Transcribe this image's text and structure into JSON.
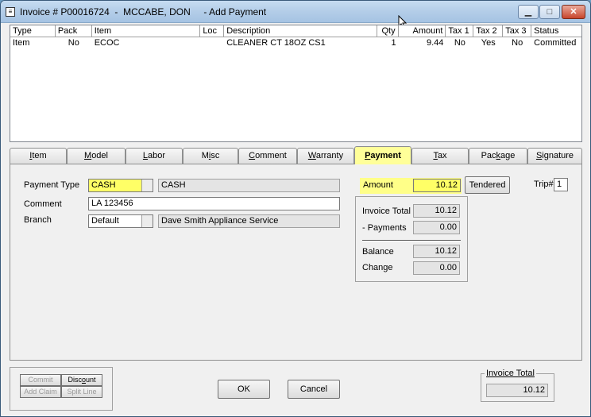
{
  "window": {
    "title": "Invoice # P00016724  -  MCCABE, DON     - Add Payment",
    "icon": "document-icon",
    "buttons": {
      "minimize": "▁",
      "maximize": "□",
      "close": "✕"
    }
  },
  "grid": {
    "columns": [
      "Type",
      "Pack",
      "Item",
      "Loc",
      "Description",
      "Qty",
      "Amount",
      "Tax 1",
      "Tax 2",
      "Tax 3",
      "Status"
    ],
    "rows": [
      {
        "type": "Item",
        "pack": "No",
        "item": "ECOC",
        "loc": "",
        "description": "CLEANER CT 18OZ CS1",
        "qty": "1",
        "amount": "9.44",
        "tax1": "No",
        "tax2": "Yes",
        "tax3": "No",
        "status": "Committed"
      }
    ]
  },
  "tabs": [
    {
      "pre": "",
      "key": "I",
      "post": "tem"
    },
    {
      "pre": "",
      "key": "M",
      "post": "odel"
    },
    {
      "pre": "",
      "key": "L",
      "post": "abor"
    },
    {
      "pre": "M",
      "key": "i",
      "post": "sc"
    },
    {
      "pre": "",
      "key": "C",
      "post": "omment"
    },
    {
      "pre": "",
      "key": "W",
      "post": "arranty"
    },
    {
      "pre": "",
      "key": "P",
      "post": "ayment"
    },
    {
      "pre": "",
      "key": "T",
      "post": "ax"
    },
    {
      "pre": "Pac",
      "key": "k",
      "post": "age"
    },
    {
      "pre": "",
      "key": "S",
      "post": "ignature"
    }
  ],
  "payment": {
    "payment_type_label": "Payment Type",
    "payment_type_code": "CASH",
    "payment_type_desc": "CASH",
    "comment_label": "Comment",
    "comment_value": "LA 123456",
    "branch_label": "Branch",
    "branch_code": "Default",
    "branch_desc": "Dave Smith Appliance Service",
    "amount_label": "Amount",
    "amount_value": "10.12",
    "tendered_label": "Tendered",
    "trip_label": "Trip#",
    "trip_value": "1",
    "invoice_total_label": "Invoice Total",
    "invoice_total_value": "10.12",
    "payments_label": "- Payments",
    "payments_value": "0.00",
    "balance_label": "Balance",
    "balance_value": "10.12",
    "change_label": "Change",
    "change_value": "0.00"
  },
  "footer": {
    "commit": "Commit",
    "discount_pre": "Disc",
    "discount_key": "o",
    "discount_post": "unt",
    "add_claim": "Add Claim",
    "split_line": "Split Line",
    "ok": "OK",
    "cancel": "Cancel",
    "invoice_total_label": "Invoice Total",
    "invoice_total_value": "10.12"
  },
  "colors": {
    "highlight": "#ffff66",
    "active_tab": "#ffff99"
  }
}
